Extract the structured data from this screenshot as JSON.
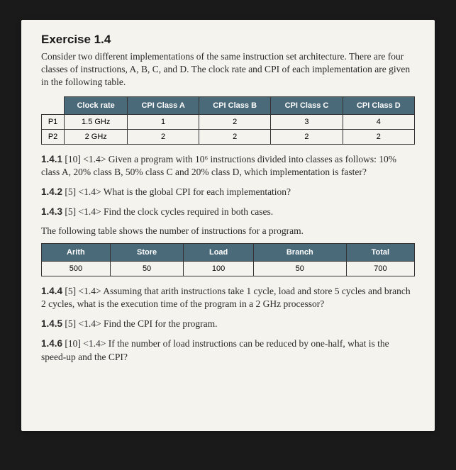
{
  "title": "Exercise 1.4",
  "intro": "Consider two different implementations of the same instruction set architecture. There are four classes of instructions, A, B, C, and D. The clock rate and CPI of each implementation are given in the following table.",
  "table1": {
    "headers": [
      "",
      "Clock rate",
      "CPI Class A",
      "CPI Class B",
      "CPI Class C",
      "CPI Class D"
    ],
    "rows": [
      [
        "P1",
        "1.5 GHz",
        "1",
        "2",
        "3",
        "4"
      ],
      [
        "P2",
        "2 GHz",
        "2",
        "2",
        "2",
        "2"
      ]
    ]
  },
  "q141_num": "1.4.1",
  "q141_text": " [10] <1.4> Given a program with 10⁶ instructions divided into classes as follows: 10% class A, 20% class B, 50% class C and 20% class D, which implementation is faster?",
  "q142_num": "1.4.2",
  "q142_text": " [5] <1.4> What is the global CPI for each implementation?",
  "q143_num": "1.4.3",
  "q143_text": " [5] <1.4> Find the clock cycles required in both cases.",
  "sub1": "The following table shows the number of instructions for a program.",
  "table2": {
    "headers": [
      "Arith",
      "Store",
      "Load",
      "Branch",
      "Total"
    ],
    "rows": [
      [
        "500",
        "50",
        "100",
        "50",
        "700"
      ]
    ]
  },
  "q144_num": "1.4.4",
  "q144_text": " [5] <1.4> Assuming that arith instructions take 1 cycle, load and store 5 cycles and branch 2 cycles, what is the execution time of the program in a 2 GHz processor?",
  "q145_num": "1.4.5",
  "q145_text": " [5] <1.4> Find the CPI for the program.",
  "q146_num": "1.4.6",
  "q146_text": " [10] <1.4> If the number of load instructions can be reduced by one-half, what is the speed-up and the CPI?"
}
